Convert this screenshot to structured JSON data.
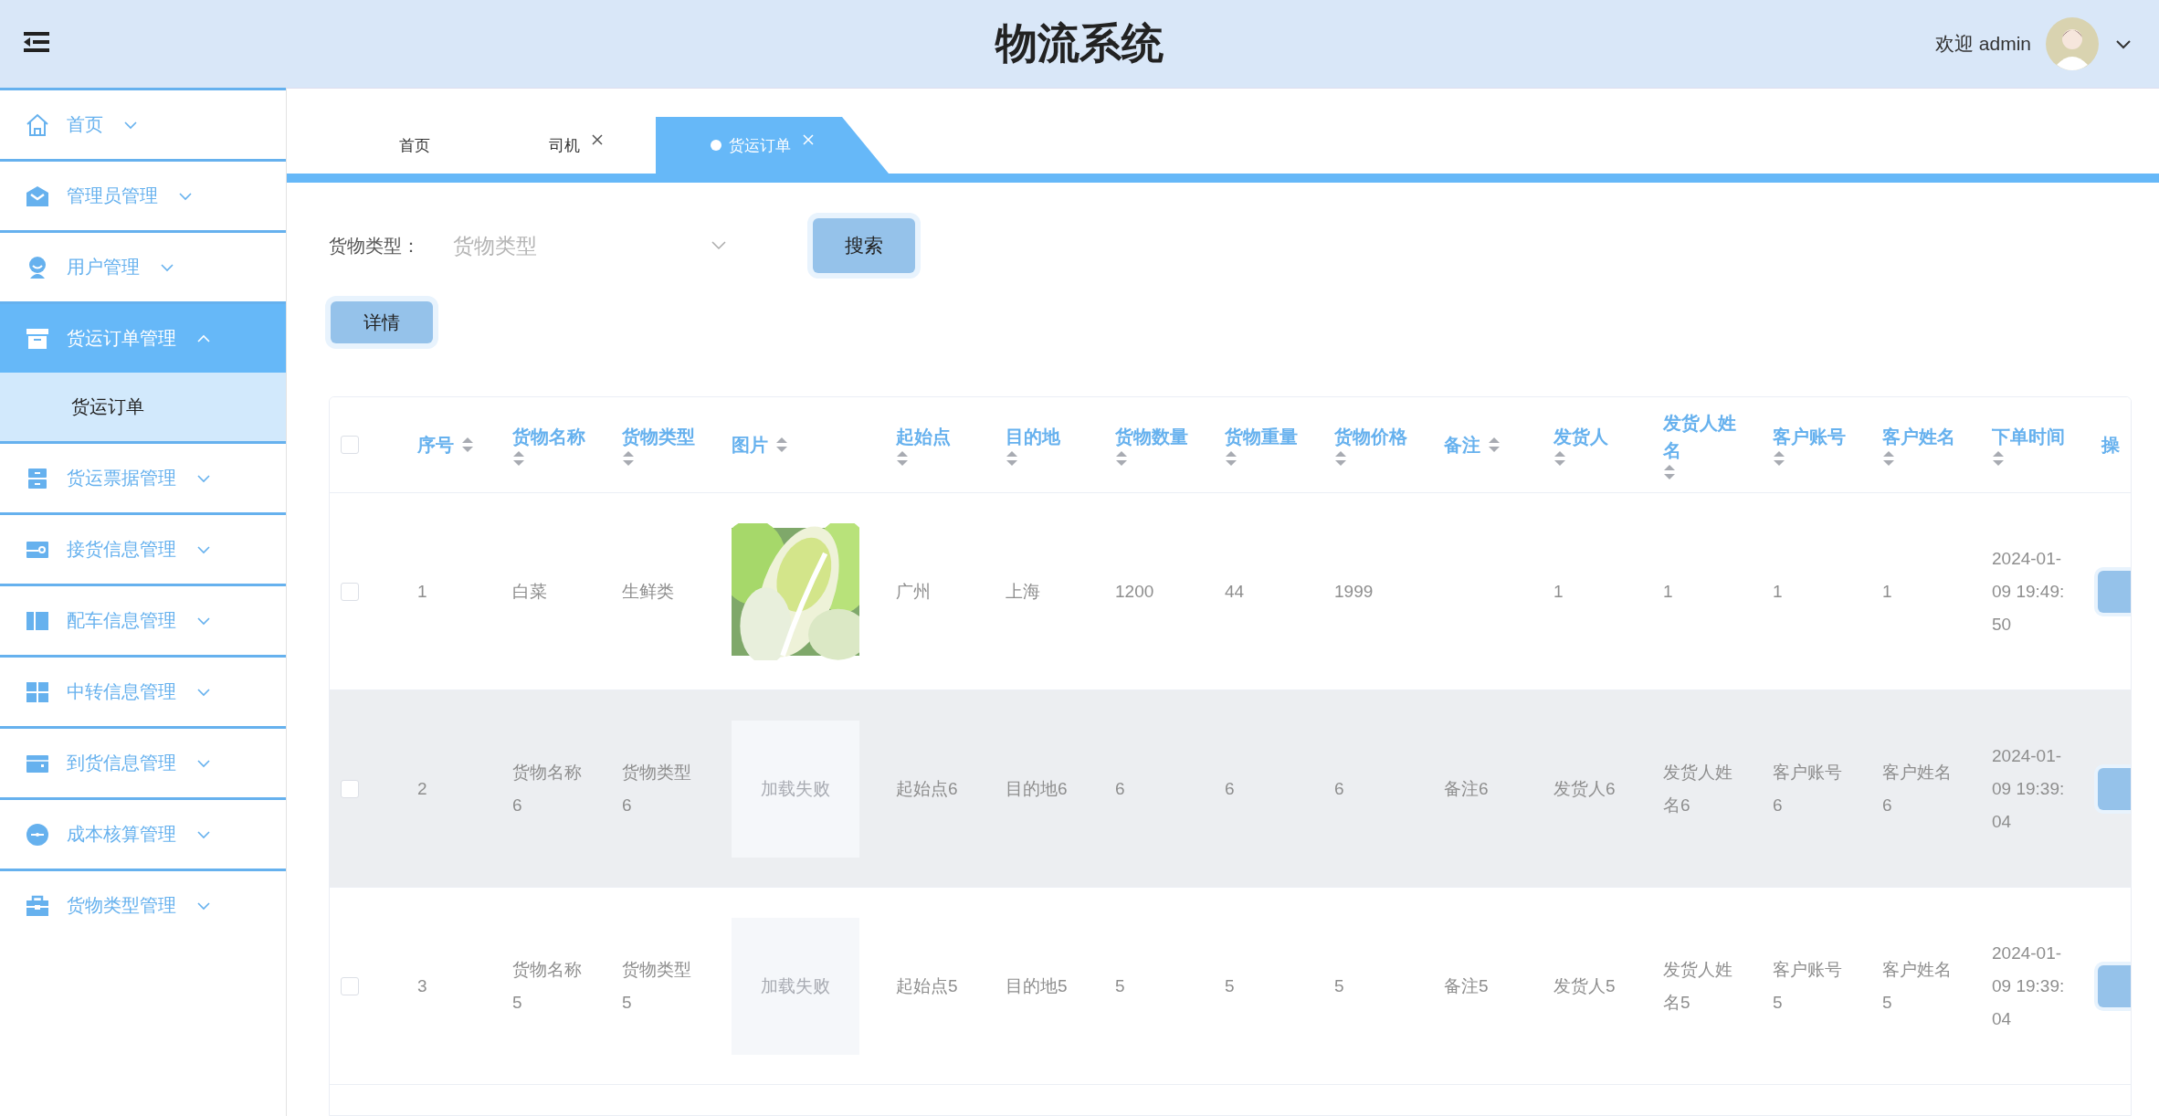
{
  "header": {
    "title": "物流系统",
    "welcome": "欢迎 admin"
  },
  "sidebar": {
    "items": [
      {
        "label": "首页",
        "expanded": false,
        "selected": false
      },
      {
        "label": "管理员管理",
        "expanded": false,
        "selected": false
      },
      {
        "label": "用户管理",
        "expanded": false,
        "selected": false
      },
      {
        "label": "货运订单管理",
        "expanded": true,
        "selected": true,
        "children": [
          {
            "label": "货运订单",
            "selected": true
          }
        ]
      },
      {
        "label": "货运票据管理",
        "expanded": false,
        "selected": false
      },
      {
        "label": "接货信息管理",
        "expanded": false,
        "selected": false
      },
      {
        "label": "配车信息管理",
        "expanded": false,
        "selected": false
      },
      {
        "label": "中转信息管理",
        "expanded": false,
        "selected": false
      },
      {
        "label": "到货信息管理",
        "expanded": false,
        "selected": false
      },
      {
        "label": "成本核算管理",
        "expanded": false,
        "selected": false
      },
      {
        "label": "货物类型管理",
        "expanded": false,
        "selected": false
      }
    ]
  },
  "tabs": [
    {
      "label": "首页",
      "closable": false,
      "selected": false
    },
    {
      "label": "司机",
      "closable": true,
      "selected": false
    },
    {
      "label": "货运订单",
      "closable": true,
      "selected": true
    }
  ],
  "search": {
    "label": "货物类型：",
    "placeholder": "货物类型",
    "button": "搜索"
  },
  "actions": [
    "详情"
  ],
  "table": {
    "striped": true,
    "select_all": {
      "checked": false
    },
    "columns": [
      {
        "label": "序号",
        "kind": "text",
        "sortable": true
      },
      {
        "label": "货物名称",
        "kind": "text",
        "sortable": true
      },
      {
        "label": "货物类型",
        "kind": "text",
        "sortable": true
      },
      {
        "label": "图片",
        "sortable": true
      },
      {
        "label": "起始点",
        "kind": "text",
        "sortable": true
      },
      {
        "label": "目的地",
        "kind": "text",
        "sortable": true
      },
      {
        "label": "货物数量",
        "kind": "text",
        "sortable": true
      },
      {
        "label": "货物重量",
        "kind": "text",
        "sortable": true
      },
      {
        "label": "货物价格",
        "kind": "text",
        "sortable": true
      },
      {
        "label": "备注",
        "kind": "text",
        "sortable": true
      },
      {
        "label": "发货人",
        "kind": "text",
        "sortable": true
      },
      {
        "label": "发货人姓名",
        "kind": "text",
        "sortable": true
      },
      {
        "label": "客户账号",
        "kind": "text",
        "sortable": true
      },
      {
        "label": "客户姓名",
        "kind": "text",
        "sortable": true
      },
      {
        "label": "下单时间",
        "kind": "text",
        "sortable": true
      },
      {
        "label": "操",
        "kind": "action",
        "sortable": false
      }
    ],
    "rows": [
      {
        "checked": false,
        "cells": [
          {
            "text": "1"
          },
          {
            "text": "白菜"
          },
          {
            "text": "生鲜类"
          },
          {
            "kind": "picture"
          },
          {
            "text": "广州"
          },
          {
            "text": "上海"
          },
          {
            "text": "1200"
          },
          {
            "text": "44"
          },
          {
            "text": "1999"
          },
          {},
          {
            "text": "1"
          },
          {
            "text": "1"
          },
          {
            "text": "1"
          },
          {
            "text": "1"
          },
          {
            "text": "2024-01-09 19:49:50"
          }
        ]
      },
      {
        "checked": false,
        "cells": [
          {
            "text": "2"
          },
          {
            "text": "货物名称6"
          },
          {
            "text": "货物类型6"
          },
          {
            "kind": "failed",
            "text": "加载失败"
          },
          {
            "text": "起始点6"
          },
          {
            "text": "目的地6"
          },
          {
            "text": "6"
          },
          {
            "text": "6"
          },
          {
            "text": "6"
          },
          {
            "text": "备注6"
          },
          {
            "text": "发货人6"
          },
          {
            "text": "发货人姓名6"
          },
          {
            "text": "客户账号6"
          },
          {
            "text": "客户姓名6"
          },
          {
            "text": "2024-01-09 19:39:04"
          }
        ]
      },
      {
        "checked": false,
        "cells": [
          {
            "text": "3"
          },
          {
            "text": "货物名称5"
          },
          {
            "text": "货物类型5"
          },
          {
            "kind": "failed",
            "text": "加载失败"
          },
          {
            "text": "起始点5"
          },
          {
            "text": "目的地5"
          },
          {
            "text": "5"
          },
          {
            "text": "5"
          },
          {
            "text": "5"
          },
          {
            "text": "备注5"
          },
          {
            "text": "发货人5"
          },
          {
            "text": "发货人姓名5"
          },
          {
            "text": "客户账号5"
          },
          {
            "text": "客户姓名5"
          },
          {
            "text": "2024-01-09 19:39:04"
          }
        ]
      }
    ]
  }
}
